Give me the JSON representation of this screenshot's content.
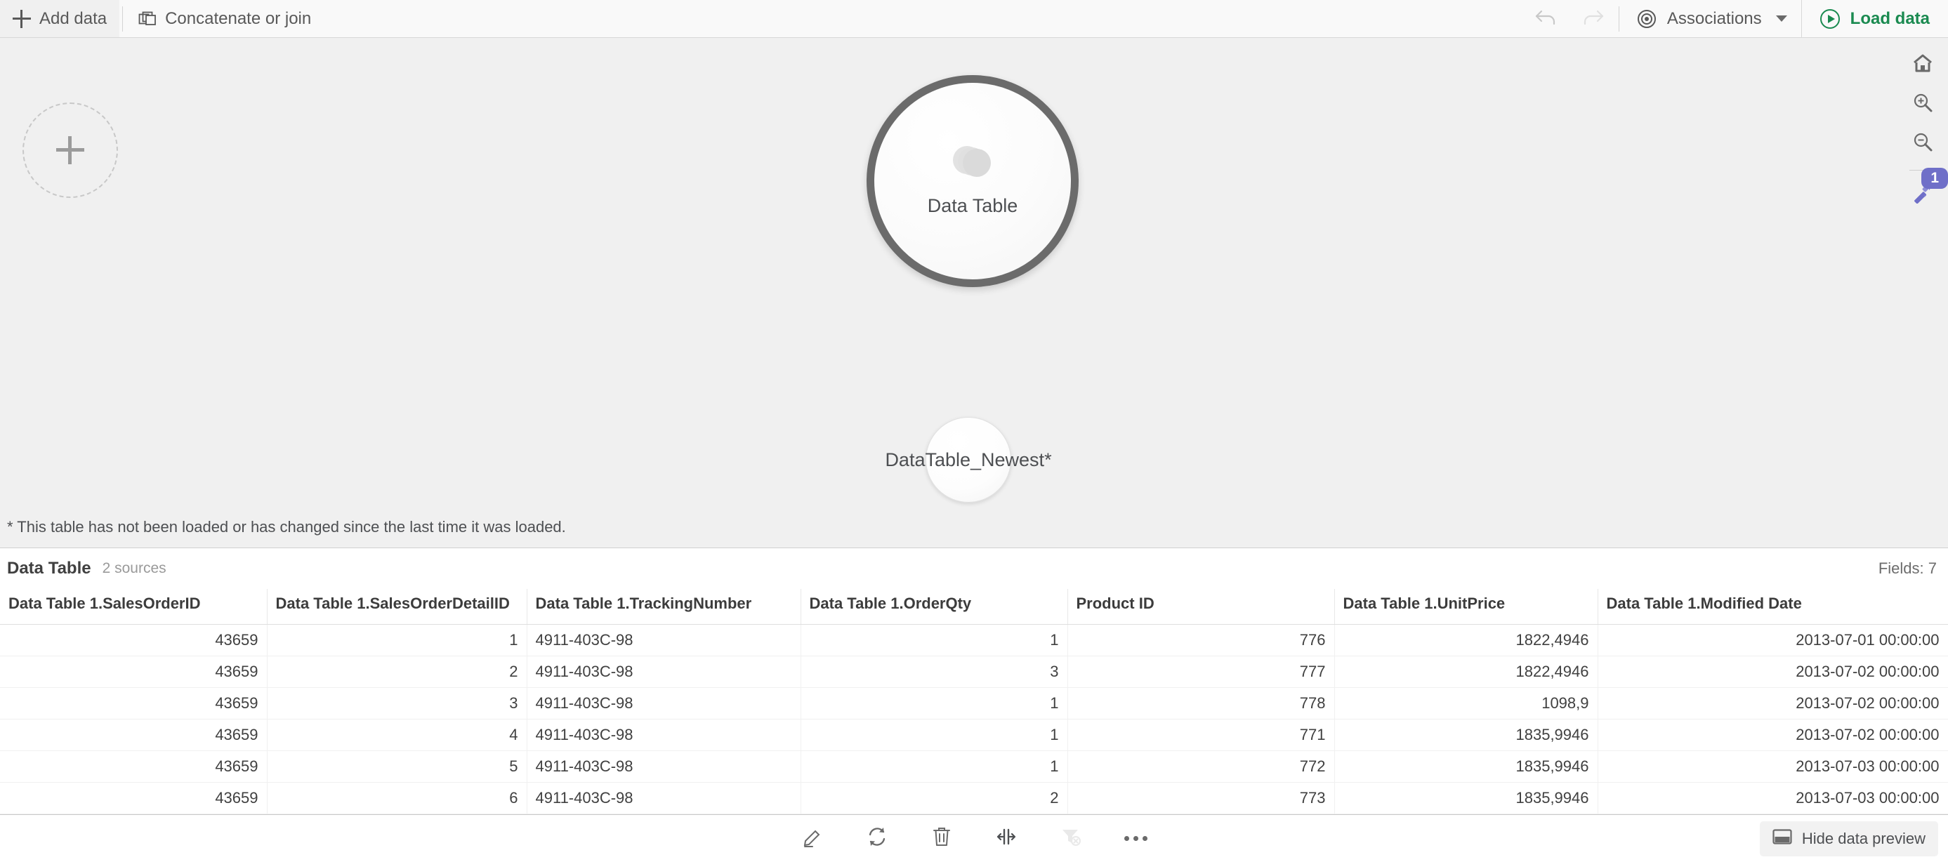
{
  "toolbar": {
    "add_data_label": "Add data",
    "concatenate_label": "Concatenate or join",
    "associations_label": "Associations",
    "load_data_label": "Load data",
    "undo_icon": "undo-icon",
    "redo_icon": "redo-icon",
    "accent_green": "#1a8a50"
  },
  "canvas": {
    "add_table_icon": "plus-icon",
    "tables": [
      {
        "name": "Data Table",
        "icon": "stacked-disks-icon",
        "selected": true
      },
      {
        "name": "DataTable_Newest*",
        "selected": false
      }
    ],
    "footnote": "* This table has not been loaded or has changed since the last time it was loaded.",
    "nav": {
      "home_icon": "home-icon",
      "zoom_in_icon": "zoom-in-icon",
      "zoom_out_icon": "zoom-out-icon",
      "magic_icon": "magic-wand-icon",
      "magic_badge": "1",
      "badge_color": "#6f6fc8"
    }
  },
  "preview": {
    "title": "Data Table",
    "sources": "2 sources",
    "fields": "Fields: 7",
    "columns": [
      "Data Table 1.SalesOrderID",
      "Data Table 1.SalesOrderDetailID",
      "Data Table 1.TrackingNumber",
      "Data Table 1.OrderQty",
      "Product ID",
      "Data Table 1.UnitPrice",
      "Data Table 1.Modified Date"
    ],
    "rows": [
      [
        "43659",
        "1",
        "4911-403C-98",
        "1",
        "776",
        "1822,4946",
        "2013-07-01 00:00:00"
      ],
      [
        "43659",
        "2",
        "4911-403C-98",
        "3",
        "777",
        "1822,4946",
        "2013-07-02 00:00:00"
      ],
      [
        "43659",
        "3",
        "4911-403C-98",
        "1",
        "778",
        "1098,9",
        "2013-07-02 00:00:00"
      ],
      [
        "43659",
        "4",
        "4911-403C-98",
        "1",
        "771",
        "1835,9946",
        "2013-07-02 00:00:00"
      ],
      [
        "43659",
        "5",
        "4911-403C-98",
        "1",
        "772",
        "1835,9946",
        "2013-07-03 00:00:00"
      ],
      [
        "43659",
        "6",
        "4911-403C-98",
        "2",
        "773",
        "1835,9946",
        "2013-07-03 00:00:00"
      ]
    ]
  },
  "bottom": {
    "edit_icon": "edit-pencil-icon",
    "refresh_icon": "refresh-icon",
    "delete_icon": "trash-icon",
    "resize_icon": "split-columns-icon",
    "clear_filter_icon": "clear-filter-icon",
    "more_icon": "more-options-icon",
    "hide_preview_label": "Hide data preview",
    "hide_preview_icon": "panel-icon"
  }
}
